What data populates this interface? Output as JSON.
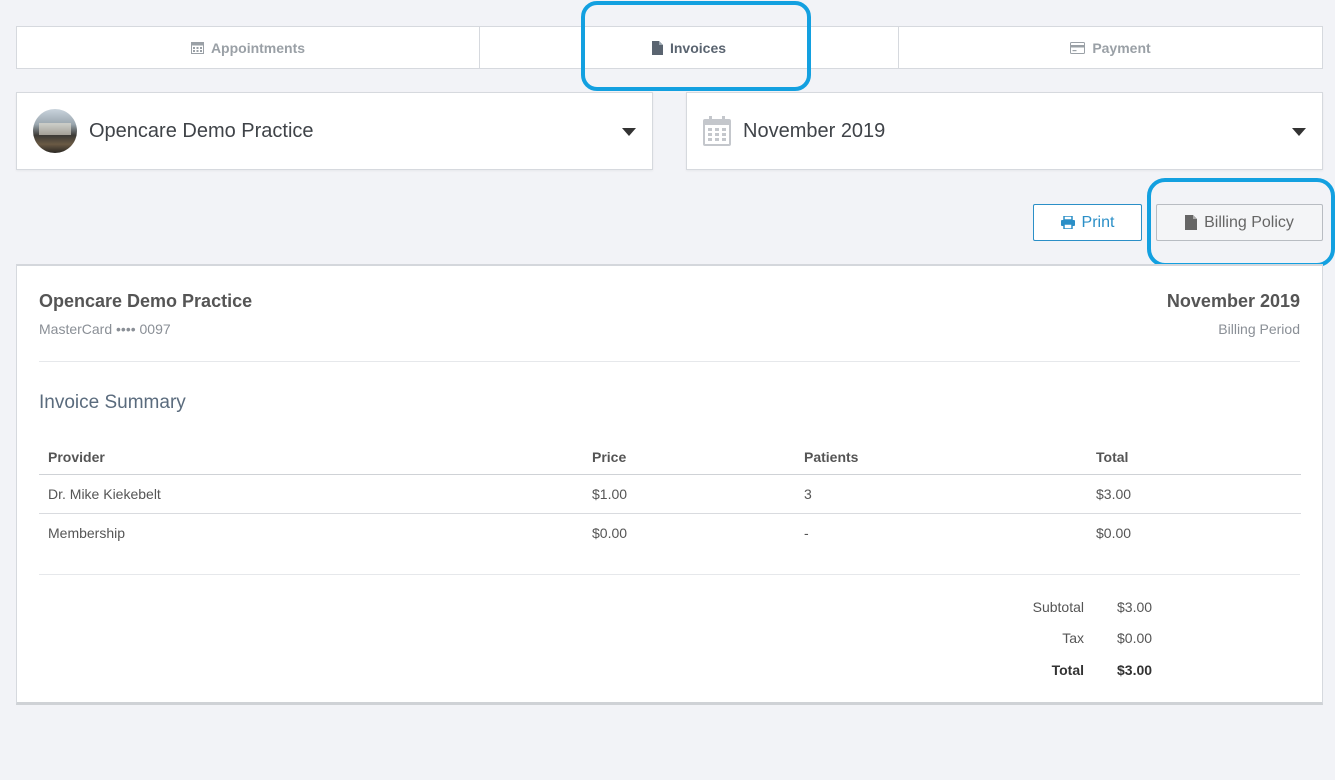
{
  "tabs": [
    {
      "label": "Appointments",
      "icon": "calendar-icon"
    },
    {
      "label": "Invoices",
      "icon": "file-icon"
    },
    {
      "label": "Payment",
      "icon": "credit-card-icon"
    }
  ],
  "practice_select": {
    "value": "Opencare Demo Practice"
  },
  "period_select": {
    "value": "November 2019"
  },
  "actions": {
    "print_label": "Print",
    "billing_policy_label": "Billing Policy"
  },
  "invoice": {
    "practice_name": "Opencare Demo Practice",
    "card": "MasterCard •••• 0097",
    "period": "November 2019",
    "period_label": "Billing Period",
    "summary_title": "Invoice Summary",
    "columns": [
      "Provider",
      "Price",
      "Patients",
      "Total"
    ],
    "rows": [
      [
        "Dr. Mike Kiekebelt",
        "$1.00",
        "3",
        "$3.00"
      ],
      [
        "Membership",
        "$0.00",
        "-",
        "$0.00"
      ]
    ],
    "subtotal_label": "Subtotal",
    "subtotal_value": "$3.00",
    "tax_label": "Tax",
    "tax_value": "$0.00",
    "total_label": "Total",
    "total_value": "$3.00"
  },
  "colors": {
    "accent": "#2b8fc7",
    "highlight": "#13a0e0",
    "background": "#f2f3f7"
  }
}
